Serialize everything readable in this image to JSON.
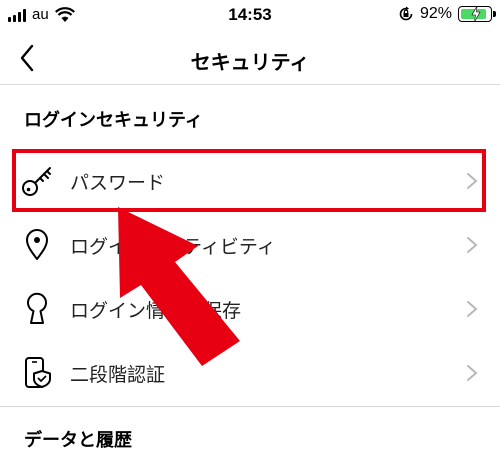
{
  "status_bar": {
    "carrier": "au",
    "time": "14:53",
    "battery_percent": "92%",
    "battery_level": 0.92,
    "icons": [
      "signal-bars-icon",
      "wifi-icon",
      "orientation-lock-icon",
      "battery-icon",
      "charging-bolt-icon"
    ]
  },
  "nav": {
    "title": "セキュリティ",
    "back_icon": "chevron-left-icon"
  },
  "sections": {
    "login_security": {
      "heading": "ログインセキュリティ",
      "items": [
        {
          "label": "パスワード",
          "icon": "key-icon"
        },
        {
          "label": "ログインアクティビティ",
          "icon": "location-pin-icon"
        },
        {
          "label": "ログイン情報を保存",
          "icon": "keyhole-icon"
        },
        {
          "label": "二段階認証",
          "icon": "phone-shield-icon"
        }
      ]
    },
    "data_history": {
      "heading": "データと履歴"
    }
  },
  "annotation": {
    "highlight_color": "#e60012",
    "arrow_color": "#e60012"
  }
}
